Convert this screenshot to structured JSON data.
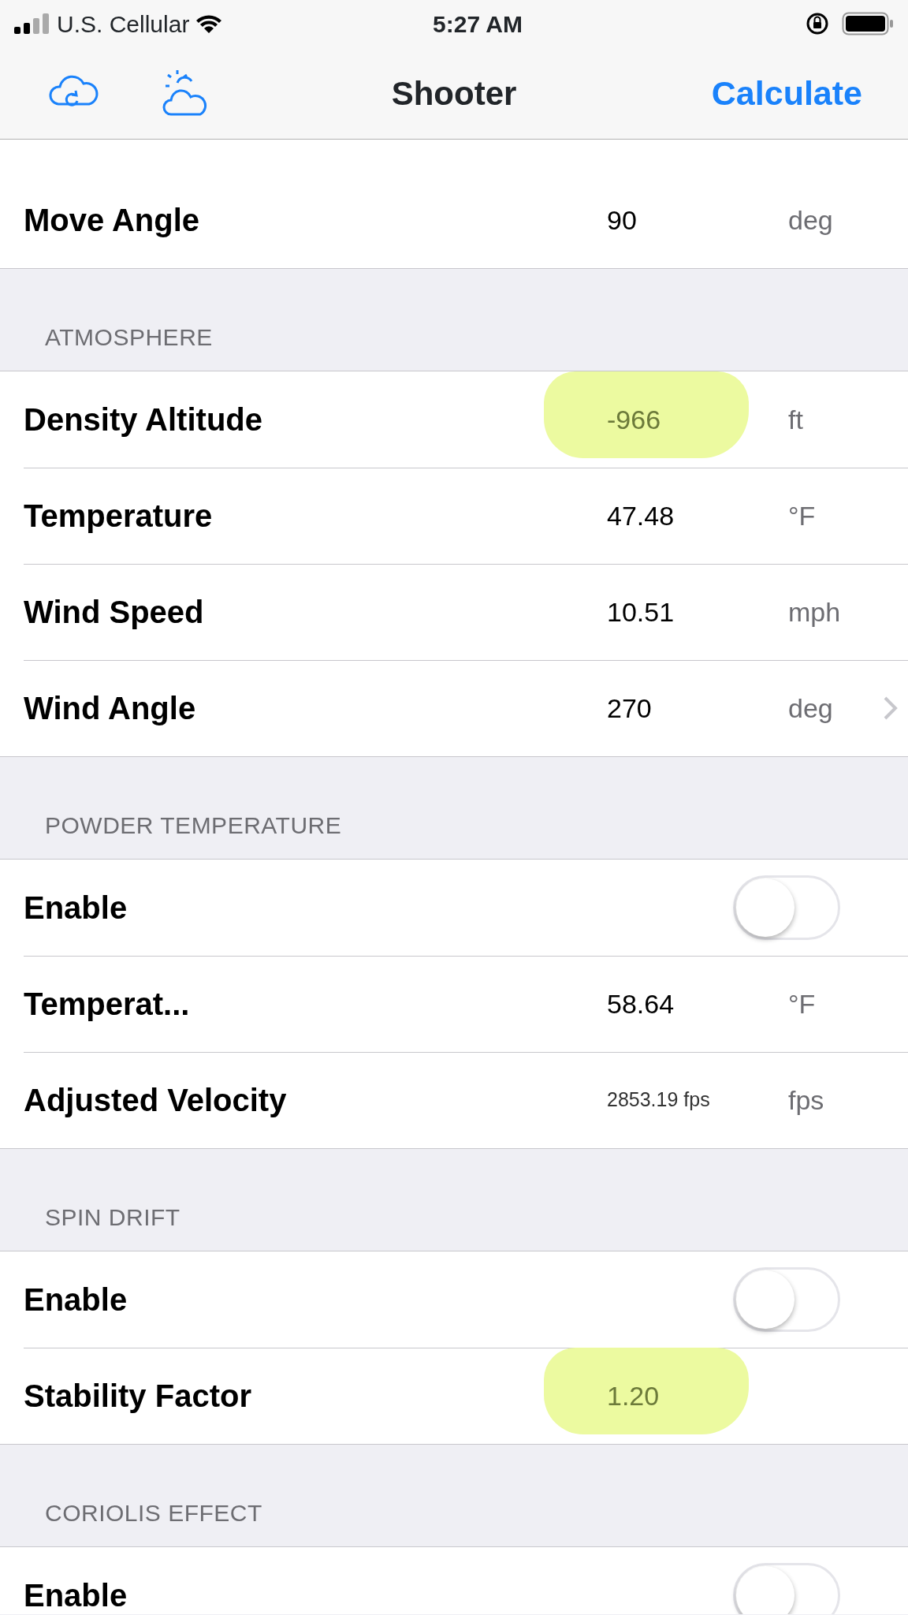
{
  "status_bar": {
    "carrier": "U.S. Cellular",
    "time": "5:27 AM"
  },
  "nav": {
    "title": "Shooter",
    "action": "Calculate"
  },
  "sections": [
    {
      "rows": [
        {
          "kind": "value",
          "label": "Move Angle",
          "value": "90",
          "unit": "deg"
        }
      ]
    },
    {
      "header": "ATMOSPHERE",
      "rows": [
        {
          "kind": "value",
          "label": "Density Altitude",
          "value": "-966",
          "unit": "ft",
          "highlighted": true,
          "dimmed": true
        },
        {
          "kind": "value",
          "label": "Temperature",
          "value": "47.48",
          "unit": "°F"
        },
        {
          "kind": "value",
          "label": "Wind Speed",
          "value": "10.51",
          "unit": "mph"
        },
        {
          "kind": "value",
          "label": "Wind Angle",
          "value": "270",
          "unit": "deg",
          "chevron": true
        }
      ]
    },
    {
      "header": "POWDER TEMPERATURE",
      "rows": [
        {
          "kind": "toggle",
          "label": "Enable",
          "on": false
        },
        {
          "kind": "value",
          "label": "Temperat...",
          "value": "58.64",
          "unit": "°F"
        },
        {
          "kind": "value",
          "label": "Adjusted Velocity",
          "value": "2853.19 fps",
          "unit": "fps",
          "small": true
        }
      ]
    },
    {
      "header": "SPIN DRIFT",
      "rows": [
        {
          "kind": "toggle",
          "label": "Enable",
          "on": false
        },
        {
          "kind": "value",
          "label": "Stability Factor",
          "value": "1.20",
          "highlighted": true,
          "dimmed": true
        }
      ]
    },
    {
      "header": "CORIOLIS EFFECT",
      "rows": [
        {
          "kind": "toggle",
          "label": "Enable",
          "on": false
        }
      ]
    }
  ]
}
